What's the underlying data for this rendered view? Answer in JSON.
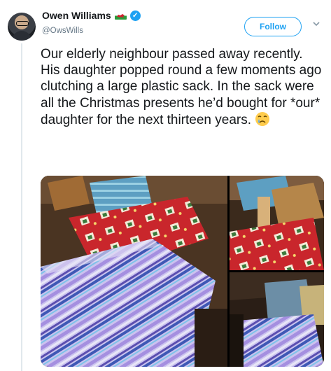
{
  "user": {
    "name": "Owen Williams",
    "handle": "@OwsWills"
  },
  "follow_label": "Follow",
  "tweet": {
    "text": "Our elderly neighbour passed away recently. His daughter popped round a few moments ago clutching a large plastic sack. In the sack were all the Christmas presents he’d bought for *our* daughter for the next thirteen years."
  },
  "icons": {
    "flag": "wales-flag-icon",
    "verified": "verified-badge-icon",
    "more": "chevron-down-icon",
    "emoji": "crying-face-emoji"
  },
  "colors": {
    "accent": "#1da1f2",
    "text": "#14171a",
    "secondary": "#657786"
  }
}
